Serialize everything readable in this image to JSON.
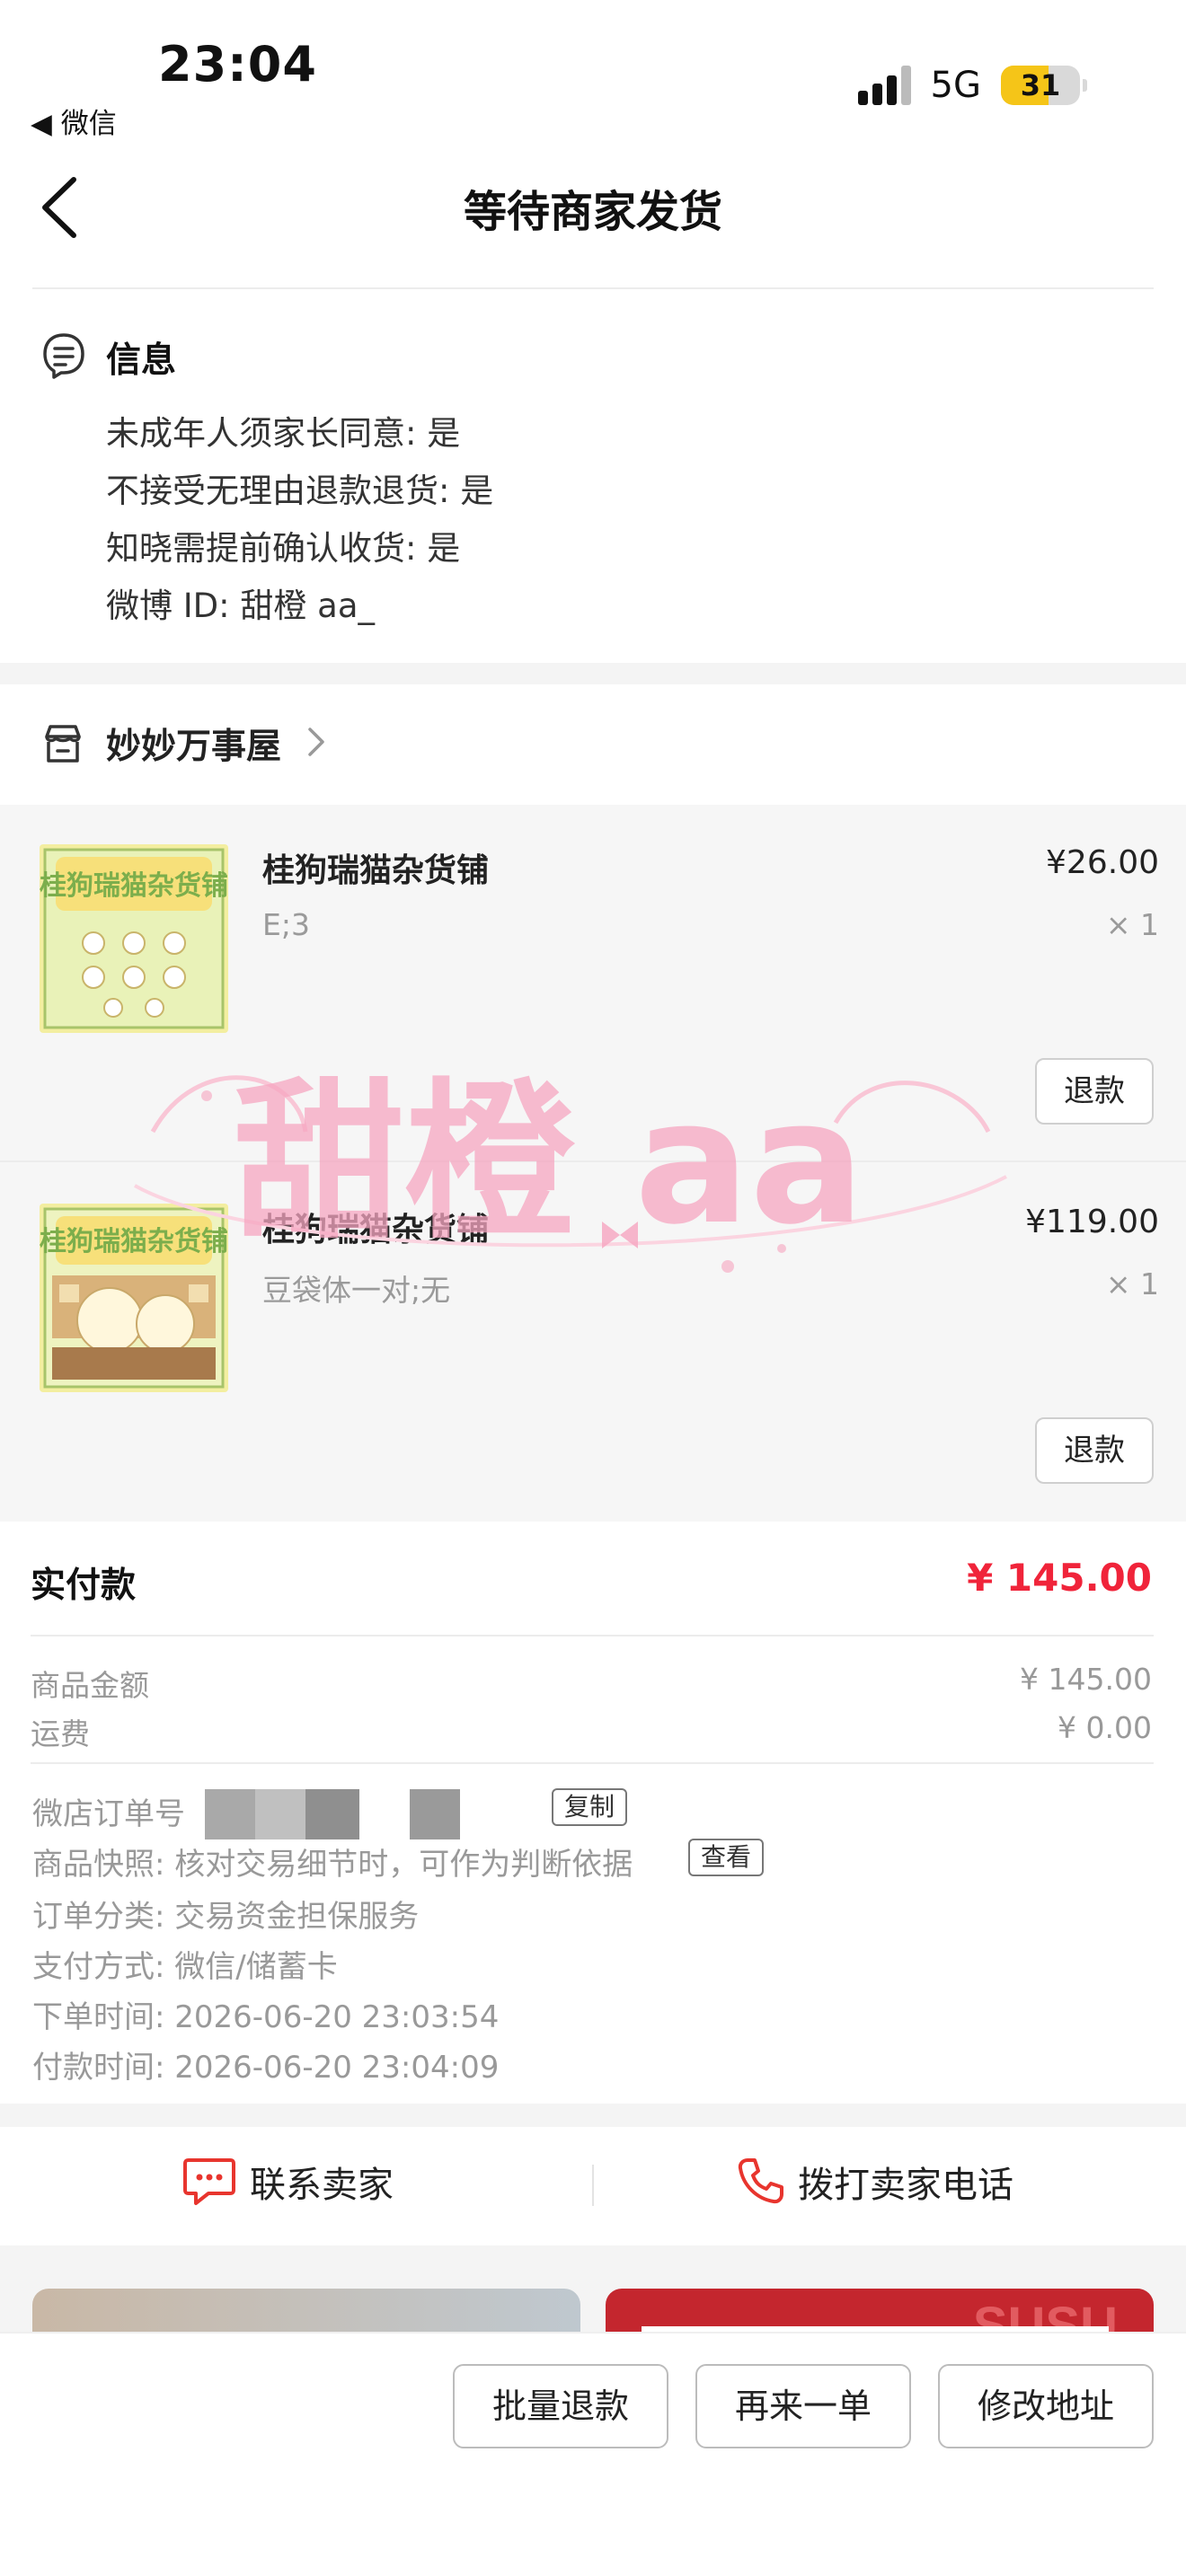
{
  "status_bar": {
    "time": "23:04",
    "back_app": "◀ 微信",
    "network": "5G",
    "battery": "31"
  },
  "nav": {
    "title": "等待商家发货"
  },
  "info": {
    "title": "信息",
    "lines": [
      "未成年人须家长同意: 是",
      "不接受无理由退款退货: 是",
      "知晓需提前确认收货: 是",
      "微博 ID: 甜橙 aa_"
    ]
  },
  "shop": {
    "name": "妙妙万事屋"
  },
  "items": [
    {
      "name": "桂狗瑞猫杂货铺",
      "spec": "E;3",
      "price": "¥26.00",
      "qty": "× 1",
      "refund_label": "退款",
      "thumb_text": "桂狗瑞猫杂货铺"
    },
    {
      "name": "桂狗瑞猫杂货铺",
      "spec": "豆袋体一对;无",
      "price": "¥119.00",
      "qty": "× 1",
      "refund_label": "退款",
      "thumb_text": "桂狗瑞猫杂货铺"
    }
  ],
  "payment": {
    "paid_label": "实付款",
    "paid_value": "¥ 145.00",
    "goods_label": "商品金额",
    "goods_value": "¥ 145.00",
    "shipping_label": "运费",
    "shipping_value": "¥ 0.00"
  },
  "order": {
    "order_no_label": "微店订单号",
    "copy_label": "复制",
    "snapshot_text": "商品快照: 核对交易细节时，可作为判断依据",
    "view_label": "查看",
    "category": "订单分类:  交易资金担保服务",
    "pay_method": "支付方式:  微信/储蓄卡",
    "order_time": "下单时间:  2026-06-20 23:03:54",
    "pay_time": "付款时间:  2026-06-20 23:04:09"
  },
  "contact": {
    "seller": "联系卖家",
    "call": "拨打卖家电话"
  },
  "cards": {
    "right_text": "SUSU"
  },
  "bottom_actions": {
    "batch_refund": "批量退款",
    "reorder": "再来一单",
    "modify_address": "修改地址"
  },
  "watermark": {
    "text": "甜橙 aa"
  },
  "colors": {
    "price_red": "#f0243a",
    "contact_red": "#e8352e",
    "watermark_pink": "#f6a5c0"
  }
}
